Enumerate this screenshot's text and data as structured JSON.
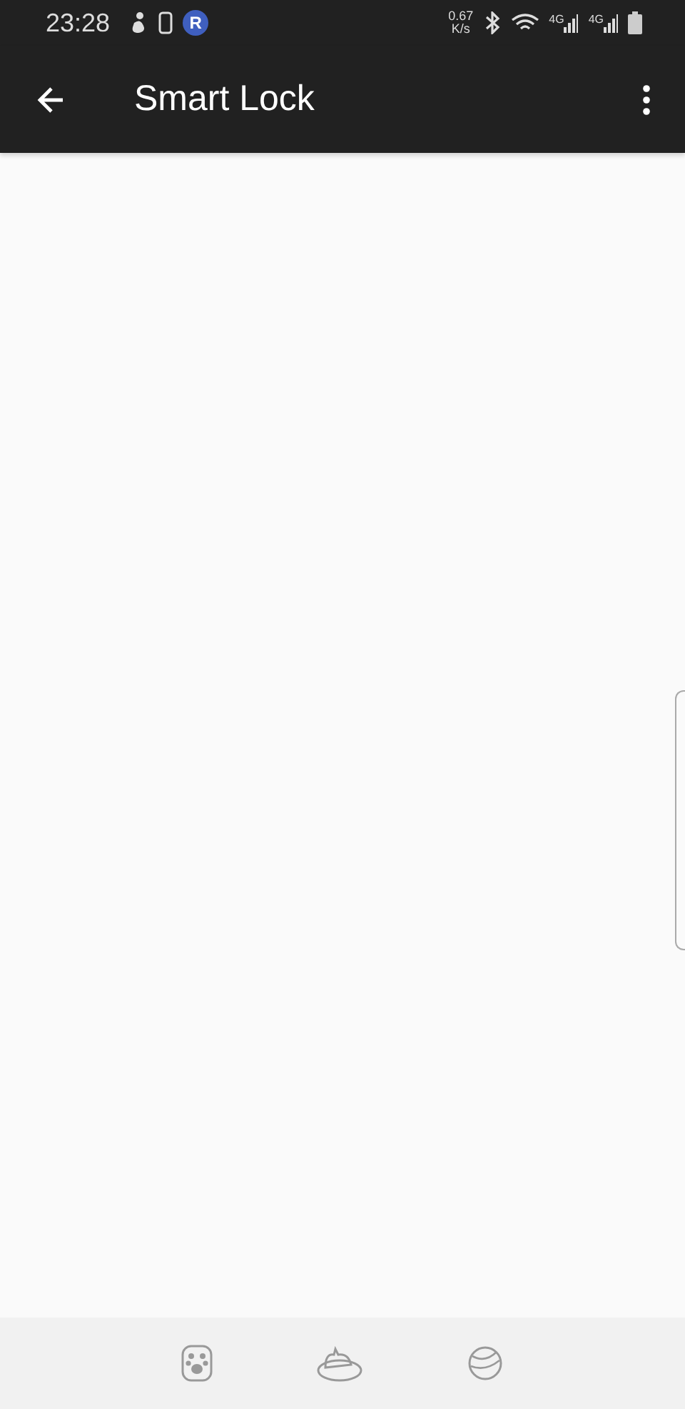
{
  "status_bar": {
    "time": "23:28",
    "app_badge": "R",
    "net_speed_value": "0.67",
    "net_speed_unit": "K/s",
    "networks": [
      "4G",
      "4G"
    ]
  },
  "app_bar": {
    "title": "Smart Lock"
  }
}
